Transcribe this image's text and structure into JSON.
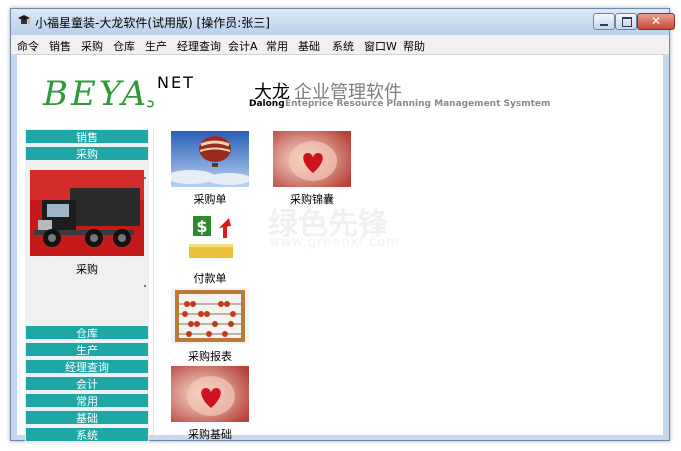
{
  "window": {
    "title": "小福星童装-大龙软件(试用版) [操作员:张三]",
    "controls": {
      "close_glyph": "✕"
    }
  },
  "menu": [
    "命令",
    "销售",
    "采购",
    "仓库",
    "生产",
    "经理查询",
    "会计A",
    "常用",
    "基础",
    "系统",
    "窗口W",
    "帮助"
  ],
  "logo": {
    "beya": "BEYA",
    "net": "NET",
    "brand_cn_black": "大龙",
    "brand_cn_gray": "企业管理软件",
    "brand_en_black": "Dalong",
    "brand_en_gray": "Enteprice Resource Planning Management Sysmtem"
  },
  "sidebar": {
    "top_buttons": [
      "销售",
      "采购"
    ],
    "selected_module": "采购",
    "bottom_buttons": [
      "仓库",
      "生产",
      "经理查询",
      "会计",
      "常用",
      "基础",
      "系统"
    ]
  },
  "functions": [
    {
      "label": "采购单",
      "icon": "balloon-icon"
    },
    {
      "label": "采购锦囊",
      "icon": "heart-glass-icon"
    },
    {
      "label": "付款单",
      "icon": "money-icon"
    },
    {
      "label": "采购报表",
      "icon": "abacus-icon"
    },
    {
      "label": "采购基础",
      "icon": "heart-glass-icon"
    }
  ],
  "watermark": {
    "text": "绿色先锋",
    "sub": "www.greenxf.com"
  },
  "colors": {
    "nav_button": "#1fa7a7",
    "logo_green": "#2e9b39",
    "close_button": "#c74b33"
  }
}
